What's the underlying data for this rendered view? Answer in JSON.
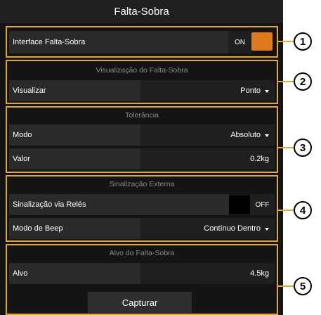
{
  "window": {
    "title": "Falta-Sobra"
  },
  "colors": {
    "accent": "#e0a82e",
    "toggle_on": "#e07a1f",
    "toggle_off": "#000000"
  },
  "sections": [
    {
      "rows": [
        {
          "label": "Interface Falta-Sobra",
          "state": "ON"
        }
      ]
    },
    {
      "header": "Visualização do Falta-Sobra",
      "rows": [
        {
          "label": "Visualizar",
          "value": "Ponto"
        }
      ]
    },
    {
      "header": "Tolerância",
      "rows": [
        {
          "label": "Modo",
          "value": "Absoluto"
        },
        {
          "label": "Valor",
          "value": "0.2kg"
        }
      ]
    },
    {
      "header": "Sinalização Externa",
      "rows": [
        {
          "label": "Sinalização via Relés",
          "state": "OFF"
        },
        {
          "label": "Modo de Beep",
          "value": "Contínuo Dentro"
        }
      ]
    },
    {
      "header": "Alvo do Falta-Sobra",
      "rows": [
        {
          "label": "Alvo",
          "value": "4.5kg"
        }
      ],
      "button": "Capturar"
    }
  ],
  "callouts": [
    "1",
    "2",
    "3",
    "4",
    "5"
  ],
  "icons": {
    "dropdown": "chevron-down-icon"
  }
}
